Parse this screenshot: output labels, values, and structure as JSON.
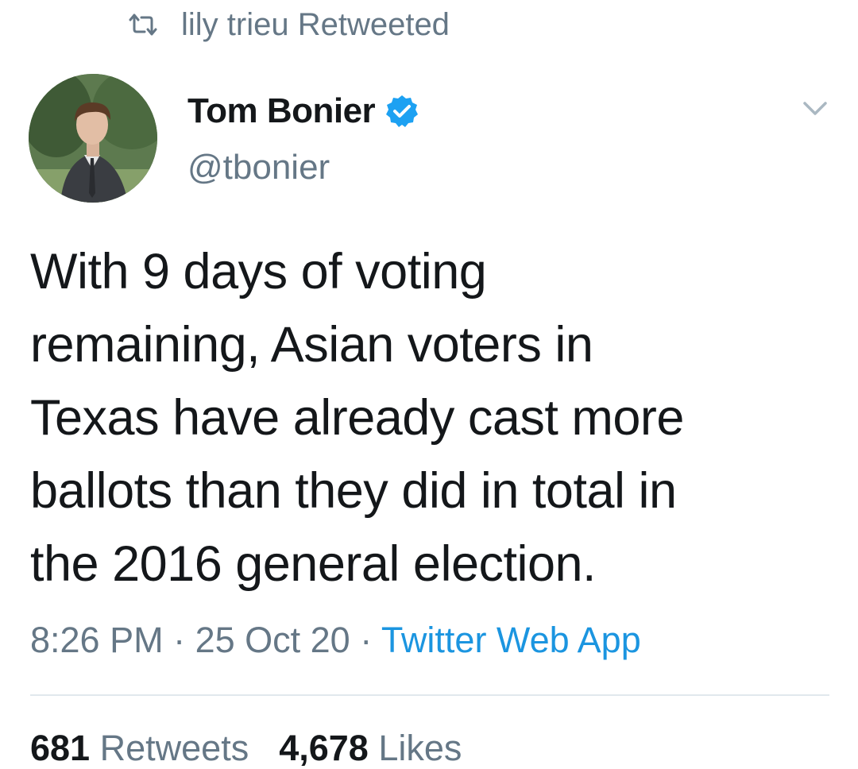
{
  "retweet_banner": {
    "icon": "retweet-icon",
    "text": "lily trieu Retweeted"
  },
  "author": {
    "name": "Tom Bonier",
    "handle": "@tbonier",
    "verified_icon": "verified-badge-icon",
    "verified_color": "#1da1f2"
  },
  "tweet": {
    "lines": [
      "With 9 days of voting",
      "remaining, Asian voters in",
      "Texas have already cast more",
      "ballots than they did in total in",
      "the 2016 general election."
    ]
  },
  "meta": {
    "time": "8:26 PM",
    "separator_1": " · ",
    "date": "25 Oct 20",
    "separator_2": " · ",
    "source": "Twitter Web App",
    "source_color": "#1b95e0"
  },
  "stats": {
    "retweets_count": "681",
    "retweets_label": "Retweets",
    "likes_count": "4,678",
    "likes_label": "Likes"
  },
  "colors": {
    "text": "#14171a",
    "secondary": "#657786",
    "divider": "#e1e8ed"
  }
}
